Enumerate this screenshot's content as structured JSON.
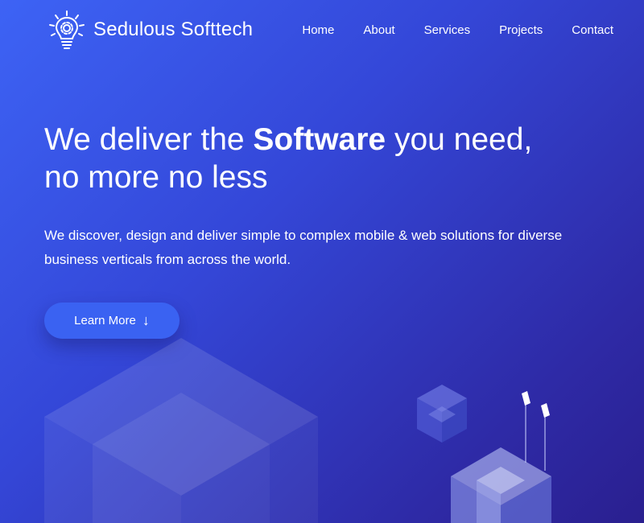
{
  "brand": {
    "name": "Sedulous Softtech",
    "logo_icon": "lightbulb-gear-icon"
  },
  "nav": {
    "items": [
      {
        "label": "Home"
      },
      {
        "label": "About"
      },
      {
        "label": "Services"
      },
      {
        "label": "Projects"
      },
      {
        "label": "Contact"
      }
    ]
  },
  "hero": {
    "title_part1": "We deliver the ",
    "title_bold": "Software",
    "title_part2": " you need,",
    "title_line2": "no more no less",
    "description": "We discover, design and deliver simple to complex mobile & web solutions for diverse business verticals from across the world.",
    "cta_label": "Learn More",
    "cta_arrow": "↓"
  },
  "colors": {
    "gradient_start": "#3d63f5",
    "gradient_end": "#2a1f8f",
    "button": "#3a62f2",
    "text": "#ffffff"
  }
}
